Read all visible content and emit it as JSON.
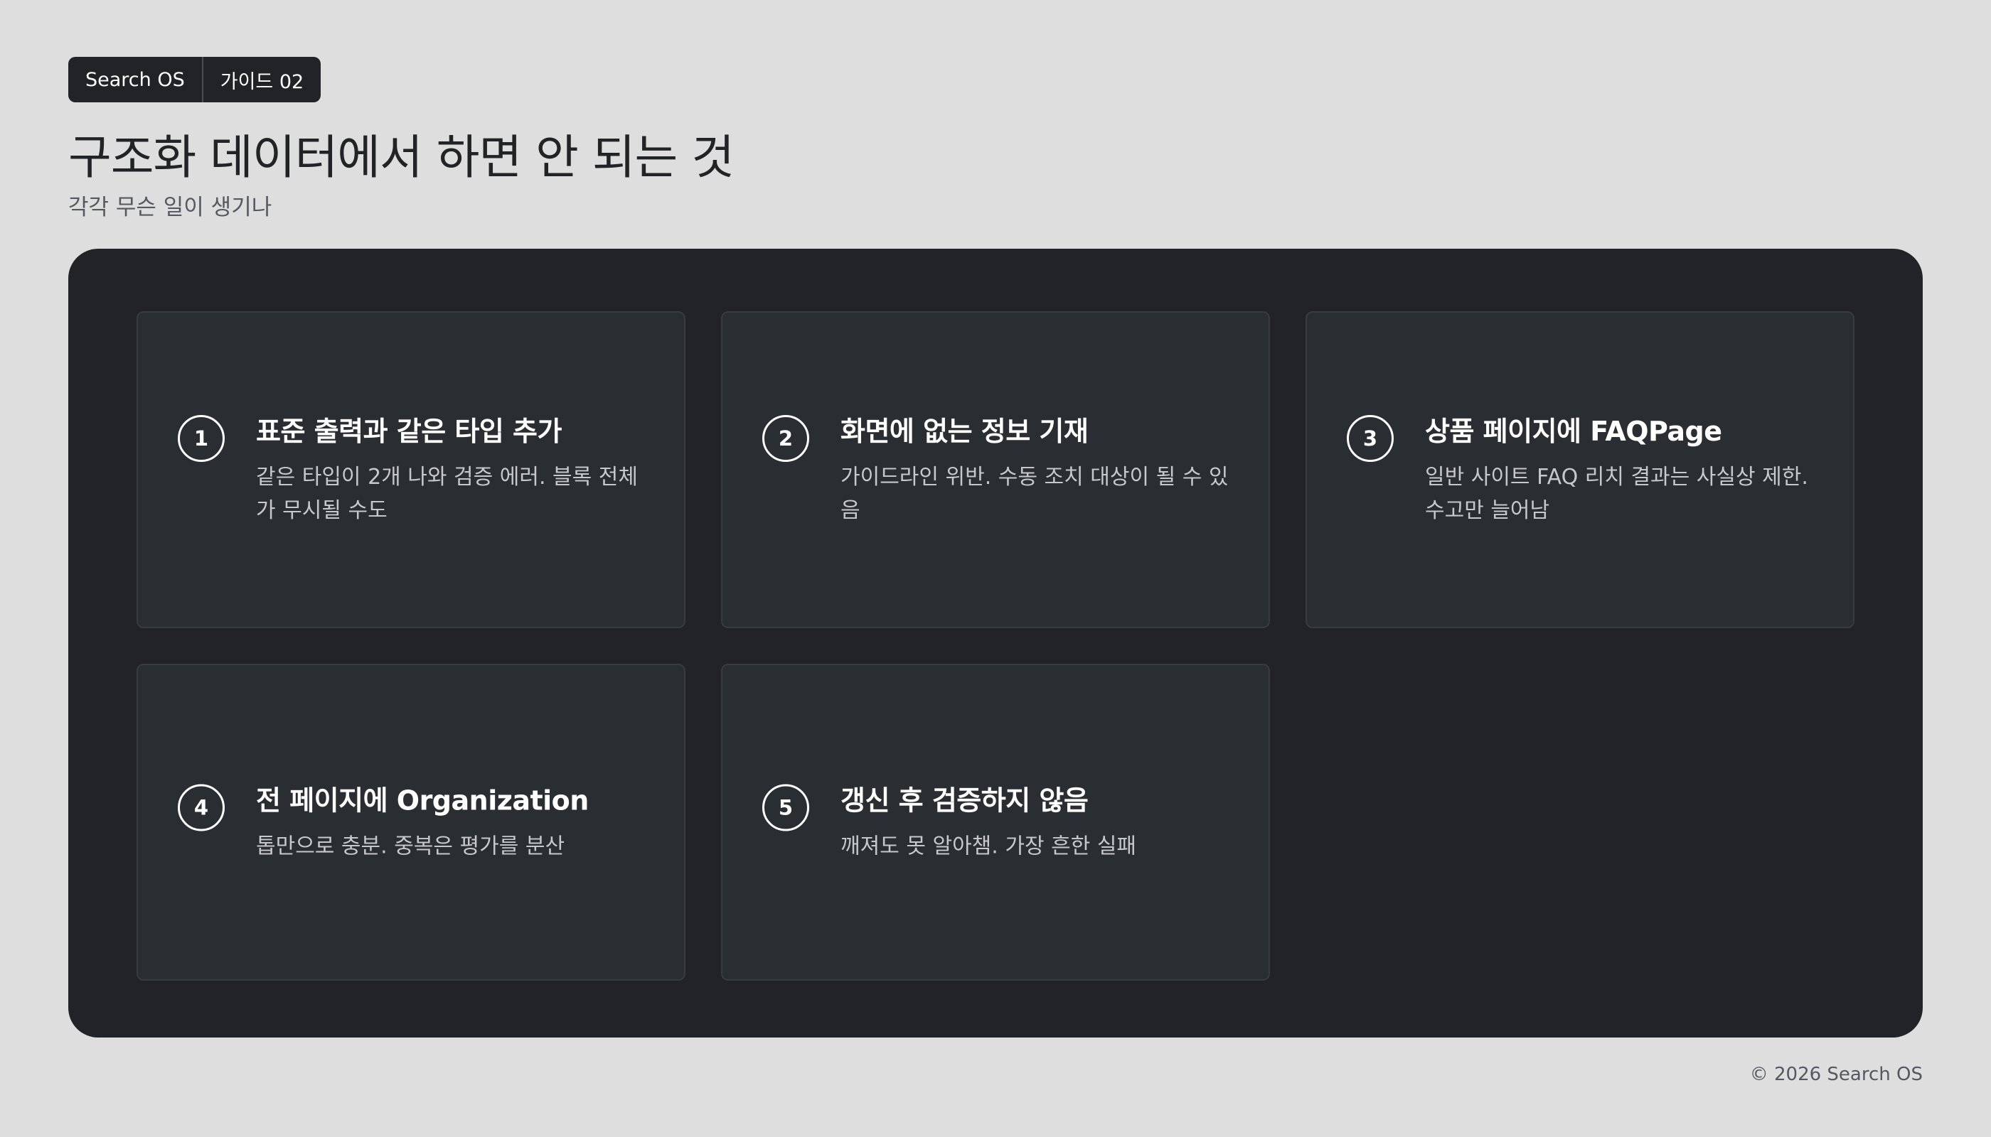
{
  "breadcrumb": {
    "brand": "Search OS",
    "guide": "가이드 02"
  },
  "header": {
    "title": "구조화 데이터에서 하면 안 되는 것",
    "subtitle": "각각 무슨 일이 생기나"
  },
  "cards": [
    {
      "number": "1",
      "title": "표준 출력과 같은 타입 추가",
      "description": "같은 타입이 2개 나와 검증 에러. 블록 전체가 무시될 수도"
    },
    {
      "number": "2",
      "title": "화면에 없는 정보 기재",
      "description": "가이드라인 위반. 수동 조치 대상이 될 수 있음"
    },
    {
      "number": "3",
      "title": "상품 페이지에 FAQPage",
      "description": "일반 사이트 FAQ 리치 결과는 사실상 제한. 수고만 늘어남"
    },
    {
      "number": "4",
      "title": "전 페이지에 Organization",
      "description": "톱만으로 충분. 중복은 평가를 분산"
    },
    {
      "number": "5",
      "title": "갱신 후 검증하지 않음",
      "description": "깨져도 못 알아챔. 가장 흔한 실패"
    }
  ],
  "footer": {
    "copyright": "© 2026 Search OS"
  }
}
